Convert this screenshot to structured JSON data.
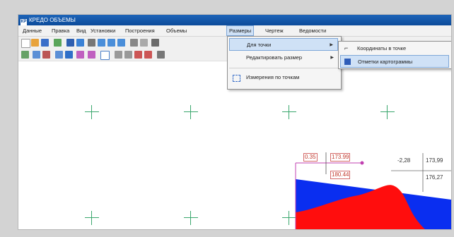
{
  "window": {
    "title": "КРЕДО ОБЪЕМЫ",
    "app_icon": "КР"
  },
  "menubar": {
    "items": [
      "Данные",
      "Правка",
      "Вид",
      "Установки",
      "Построения",
      "Объемы",
      "Размеры",
      "Чертеж",
      "Ведомости"
    ],
    "active_index": 6
  },
  "dropdown_main": {
    "items": [
      {
        "label": "Для точки",
        "has_submenu": true
      },
      {
        "label": "Редактировать размер",
        "has_submenu": true
      },
      {
        "label": "Измерения по точкам",
        "has_submenu": false
      }
    ],
    "highlighted_index": 0
  },
  "dropdown_sub": {
    "items": [
      {
        "label": "Координаты в точке"
      },
      {
        "label": "Отметки картограммы"
      }
    ],
    "highlighted_index": 1
  },
  "canvas": {
    "point_label": {
      "left": "0.35",
      "mid": "173.99",
      "bottom": "180.44"
    },
    "table": {
      "r1c1": "-2,28",
      "r1c2": "173,99",
      "r2c2": "176,27"
    }
  },
  "colors": {
    "titlebar": "#0c4b9a",
    "grid_cross": "#3aa76d",
    "fill_blue": "#0a2ef0",
    "fill_red": "#ff0d0d",
    "label": "#c0392b",
    "marker": "#c040b0"
  },
  "icons": [
    "new-icon",
    "open-icon",
    "save-icon",
    "undo-icon",
    "redo-icon",
    "zoom-in-icon",
    "zoom-out-icon",
    "pan-icon",
    "select-icon",
    "layers-icon"
  ]
}
